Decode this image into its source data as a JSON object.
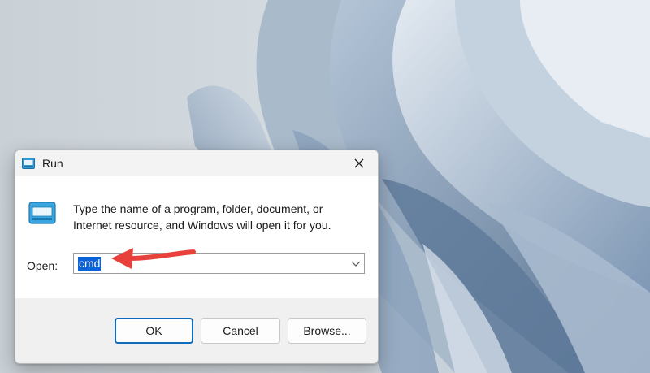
{
  "dialog": {
    "title": "Run",
    "close_icon": "close-icon",
    "app_icon": "run-window-icon",
    "description": "Type the name of a program, folder, document, or Internet resource, and Windows will open it for you.",
    "open_label_underlined": "O",
    "open_label_rest": "pen:",
    "open_value": "cmd",
    "dropdown_icon": "chevron-down-icon",
    "buttons": {
      "ok": "OK",
      "cancel": "Cancel",
      "browse_underlined": "B",
      "browse_rest": "rowse..."
    }
  },
  "annotation": {
    "color": "#e8413b",
    "icon": "arrow-left-icon"
  },
  "wallpaper": {
    "style": "windows-11-bloom-blue",
    "colors": [
      "#cfd6dc",
      "#9fb3c8",
      "#6f8aa8",
      "#3f5a7a"
    ]
  }
}
